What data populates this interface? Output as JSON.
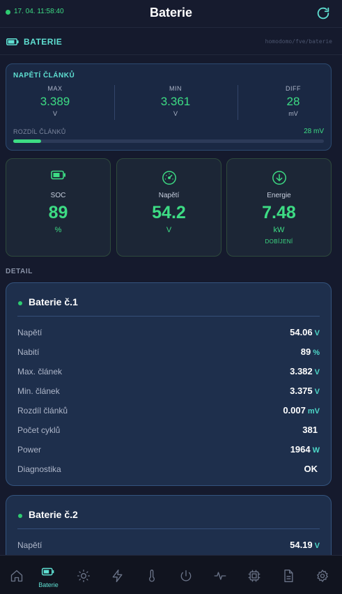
{
  "header": {
    "timestamp": "17. 04. 11:58:40",
    "title": "Baterie"
  },
  "section": {
    "title": "BATERIE",
    "path": "homodomo/fve/baterie"
  },
  "cells": {
    "title": "NAPĚTÍ ČLÁNKŮ",
    "stats": [
      {
        "label": "MAX",
        "value": "3.389",
        "unit": "V"
      },
      {
        "label": "MIN",
        "value": "3.361",
        "unit": "V"
      },
      {
        "label": "DIFF",
        "value": "28",
        "unit": "mV"
      }
    ],
    "diff_label": "ROZDÍL ČLÁNKŮ",
    "diff_value": "28 mV",
    "diff_bar_fraction": 0.09
  },
  "tiles": [
    {
      "label": "SOC",
      "value": "89",
      "unit": "%",
      "state": "",
      "icon": "battery-icon"
    },
    {
      "label": "Napětí",
      "value": "54.2",
      "unit": "V",
      "state": "",
      "icon": "gauge-icon"
    },
    {
      "label": "Energie",
      "value": "7.48",
      "unit": "kW",
      "state": "DOBÍJENÍ",
      "icon": "arrow-down-circle-icon"
    }
  ],
  "detail": {
    "label": "DETAIL",
    "batteries": [
      {
        "name": "Baterie č.1",
        "rows": [
          {
            "label": "Napětí",
            "value": "54.06",
            "unit": "V"
          },
          {
            "label": "Nabití",
            "value": "89",
            "unit": "%"
          },
          {
            "label": "Max. článek",
            "value": "3.382",
            "unit": "V"
          },
          {
            "label": "Min. článek",
            "value": "3.375",
            "unit": "V"
          },
          {
            "label": "Rozdíl článků",
            "value": "0.007",
            "unit": "mV"
          },
          {
            "label": "Počet cyklů",
            "value": "381",
            "unit": ""
          },
          {
            "label": "Power",
            "value": "1964",
            "unit": "W"
          },
          {
            "label": "Diagnostika",
            "value": "OK",
            "unit": ""
          }
        ]
      },
      {
        "name": "Baterie č.2",
        "rows": [
          {
            "label": "Napětí",
            "value": "54.19",
            "unit": "V"
          }
        ]
      }
    ]
  },
  "nav": {
    "active_label": "Baterie",
    "items": [
      "home-icon",
      "battery-icon",
      "sun-icon",
      "bolt-icon",
      "thermometer-icon",
      "power-icon",
      "pulse-icon",
      "chip-icon",
      "document-icon",
      "gear-icon"
    ]
  },
  "colors": {
    "accent": "#3ddc84",
    "teal": "#5fe0d2",
    "background": "#151a2d",
    "card": "#1e2f4c"
  }
}
